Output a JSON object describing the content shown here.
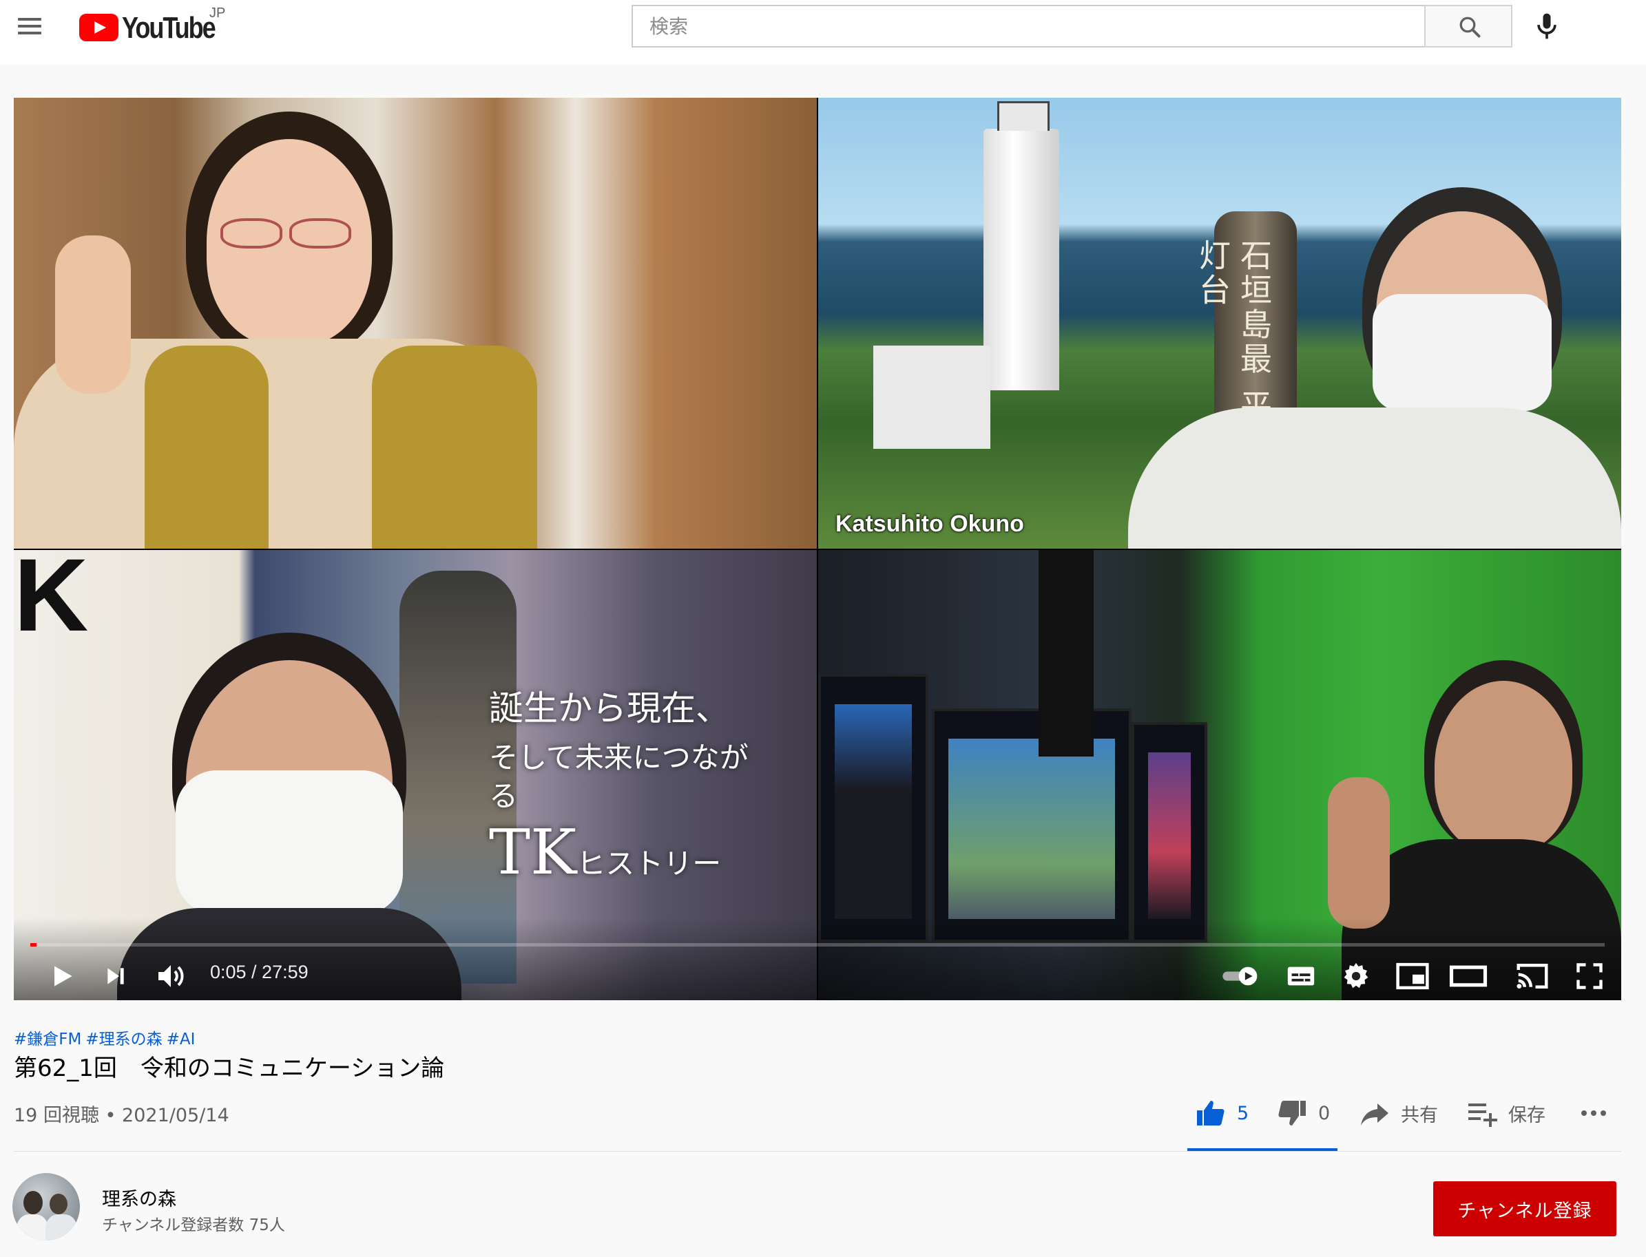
{
  "masthead": {
    "logo_text": "YouTube",
    "region": "JP",
    "search_placeholder": "検索"
  },
  "player": {
    "tile_name_label": "Katsuhito Okuno",
    "stone_text": "石垣島最 平久保崎灯台",
    "cover_letter": "K",
    "overlay": {
      "line1": "誕生から現在、",
      "line2": "そして未来につながる",
      "line3_main": "TK",
      "line3_sub": "ヒストリー"
    },
    "progress_fraction": 0.003,
    "time_display": "0:05 / 27:59",
    "controls": [
      "play",
      "next",
      "volume",
      "autoplay",
      "subtitles",
      "settings",
      "miniplayer",
      "theater",
      "cast",
      "fullscreen"
    ]
  },
  "video": {
    "hashtags": [
      "#鎌倉FM",
      "#理系の森",
      "#AI"
    ],
    "title": "第62_1回　令和のコミュニケーション論",
    "meta": "19 回視聴 • 2021/05/14"
  },
  "actions": {
    "like_count": "5",
    "dislike_count": "0",
    "share_label": "共有",
    "save_label": "保存"
  },
  "channel": {
    "name": "理系の森",
    "subscribers": "チャンネル登録者数 75人",
    "subscribe_label": "チャンネル登録"
  },
  "colors": {
    "accent_blue": "#065fd4",
    "subscribe_red": "#cc0000",
    "brand_red": "#ff0000"
  }
}
